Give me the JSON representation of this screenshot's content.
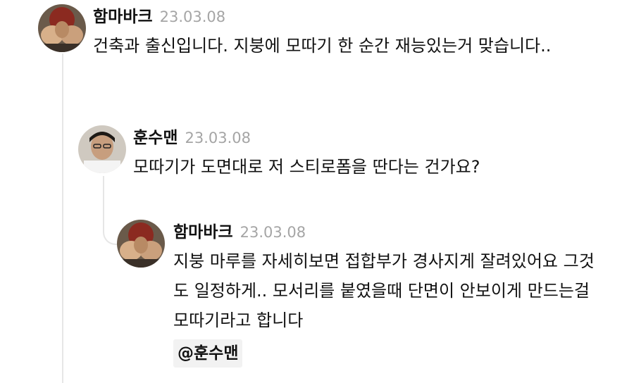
{
  "comments": [
    {
      "author": "함마바크",
      "date": "23.03.08",
      "text": "건축과 출신입니다. 지붕에 모따기 한 순간 재능있는거 맞습니다.."
    },
    {
      "author": "훈수맨",
      "date": "23.03.08",
      "text": "모따기가 도면대로 저 스티로폼을 딴다는 건가요?"
    },
    {
      "author": "함마바크",
      "date": "23.03.08",
      "text": "지붕 마루를 자세히보면 접합부가 경사지게 잘려있어요 그것도 일정하게.. 모서리를 붙였을때 단면이 안보이게 만드는걸 모따기라고 합니다",
      "mention": "@훈수맨"
    }
  ]
}
